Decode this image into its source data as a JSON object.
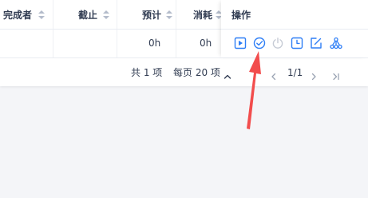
{
  "table": {
    "headers": {
      "finisher": "完成者",
      "deadline": "截止",
      "estimate": "预计",
      "consumed": "消耗",
      "actions": "操作"
    },
    "row": {
      "estimate": "0h",
      "consumed": "0h"
    },
    "action_icons": [
      "play-icon",
      "check-circle-icon",
      "power-icon",
      "clock-icon",
      "edit-icon",
      "tree-structure-icon"
    ]
  },
  "pager": {
    "total": "共 1 项",
    "per_page": "每页 20 项",
    "page": "1/1"
  },
  "colors": {
    "accent": "#2e7ef6",
    "disabled": "#c6cbd5",
    "annotation": "#f24d4d"
  }
}
